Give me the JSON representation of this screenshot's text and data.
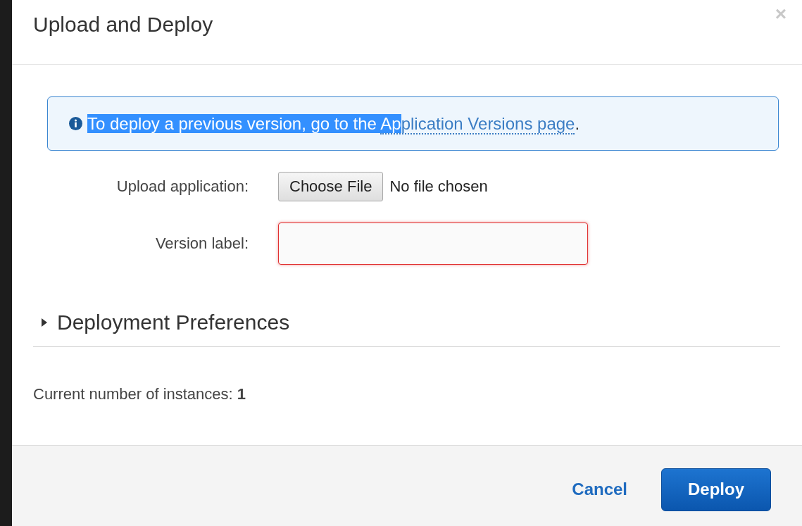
{
  "dialog": {
    "title": "Upload and Deploy",
    "close": "×"
  },
  "info": {
    "text": "To deploy a previous version, go to the ",
    "link_highlighted_part": "Ap",
    "link_rest": "plication Versions page",
    "suffix": ".",
    "highlighted": true
  },
  "fields": [
    {
      "kind": "file",
      "label": "Upload application:",
      "button": "Choose File",
      "status": "No file chosen"
    },
    {
      "kind": "text",
      "label": "Version label:",
      "invalid": true
    }
  ],
  "section": {
    "title": "Deployment Preferences",
    "expanded": false
  },
  "instances": "Current number of instances: **1**",
  "buttons": [
    {
      "kind": "link",
      "label": "Cancel"
    },
    {
      "kind": "primary",
      "label": "Deploy"
    }
  ]
}
